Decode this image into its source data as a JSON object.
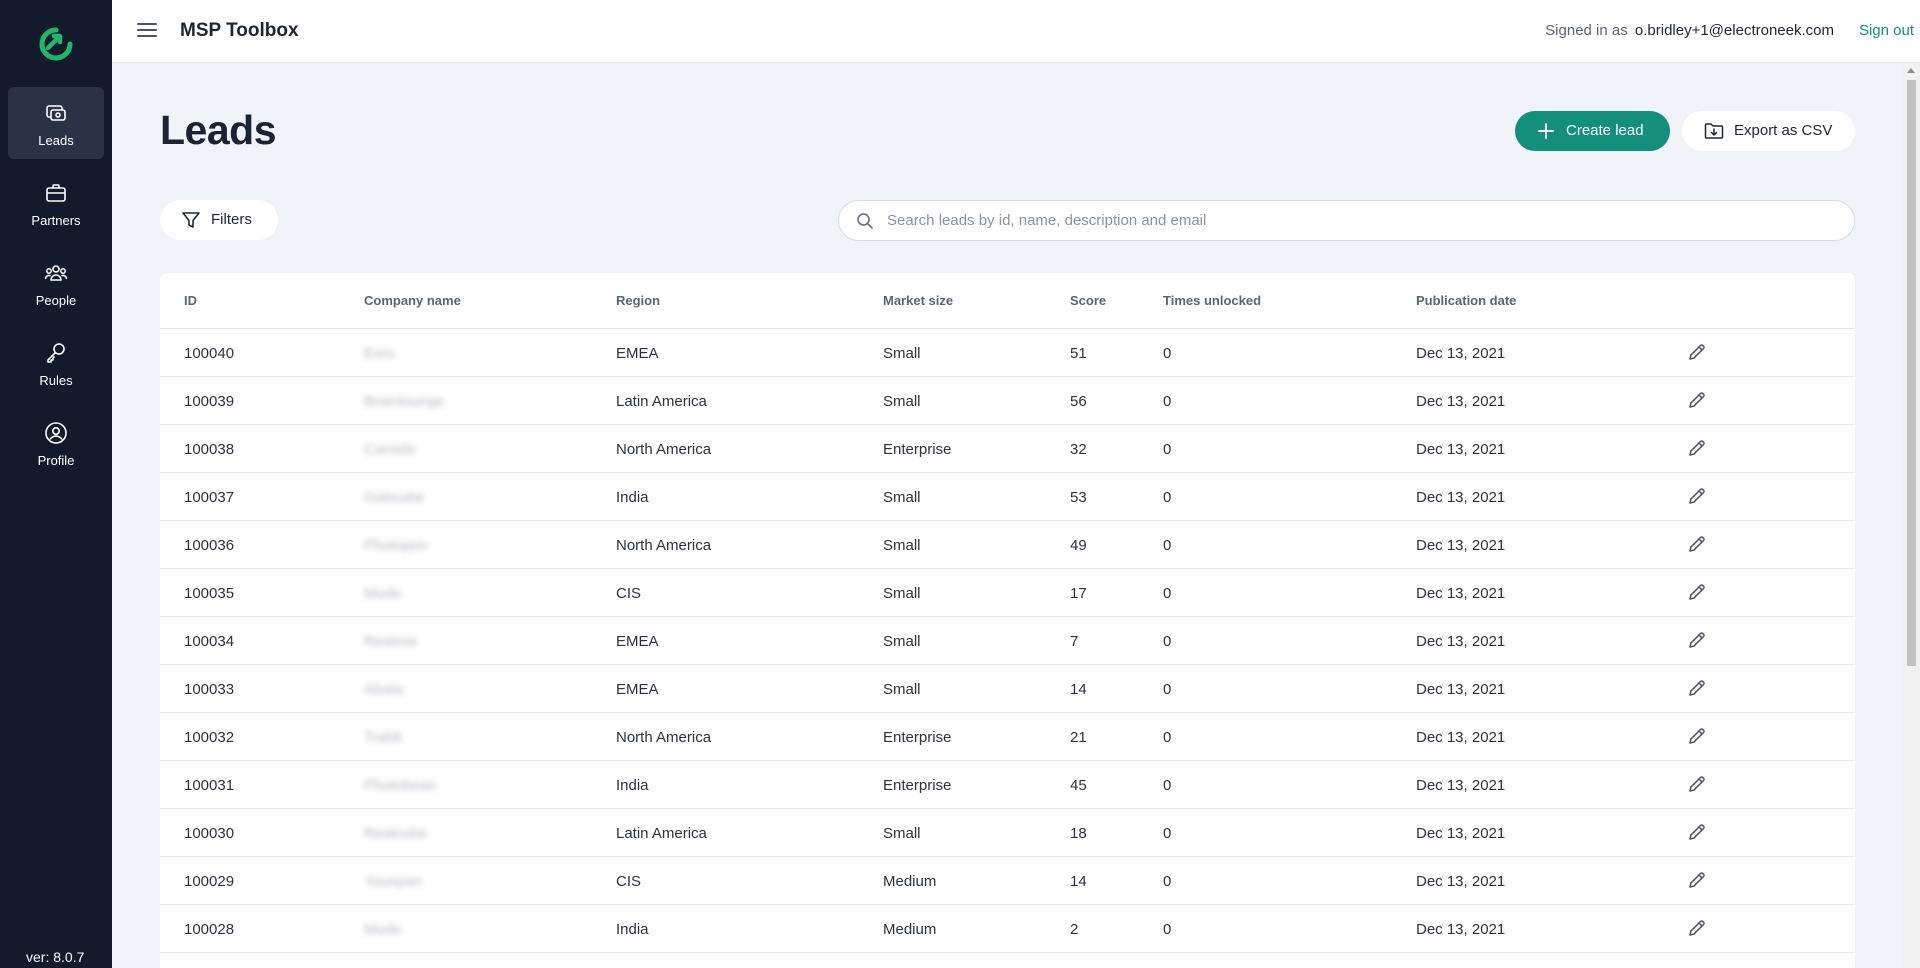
{
  "app": {
    "title": "MSP Toolbox",
    "version": "ver: 8.0.7"
  },
  "sidebar": {
    "items": [
      {
        "label": "Leads",
        "icon": "leads-icon",
        "active": true
      },
      {
        "label": "Partners",
        "icon": "briefcase-icon",
        "active": false
      },
      {
        "label": "People",
        "icon": "people-icon",
        "active": false
      },
      {
        "label": "Rules",
        "icon": "key-icon",
        "active": false
      },
      {
        "label": "Profile",
        "icon": "profile-icon",
        "active": false
      }
    ]
  },
  "header": {
    "signed_in_prefix": "Signed in as",
    "email": "o.bridley+1@electroneek.com",
    "sign_out": "Sign out"
  },
  "page": {
    "title": "Leads",
    "create_label": "Create lead",
    "export_label": "Export as CSV",
    "filters_label": "Filters",
    "search_placeholder": "Search leads by id, name, description and email"
  },
  "table": {
    "columns": [
      "ID",
      "Company name",
      "Region",
      "Market size",
      "Score",
      "Times unlocked",
      "Publication date"
    ],
    "rows": [
      {
        "id": "100040",
        "company": "Exro",
        "region": "EMEA",
        "market_size": "Small",
        "score": "51",
        "times_unlocked": "0",
        "date": "Dec 13, 2021"
      },
      {
        "id": "100039",
        "company": "Brainlounge",
        "region": "Latin America",
        "market_size": "Small",
        "score": "56",
        "times_unlocked": "0",
        "date": "Dec 13, 2021"
      },
      {
        "id": "100038",
        "company": "Camido",
        "region": "North America",
        "market_size": "Enterprise",
        "score": "32",
        "times_unlocked": "0",
        "date": "Dec 13, 2021"
      },
      {
        "id": "100037",
        "company": "Gabcube",
        "region": "India",
        "market_size": "Small",
        "score": "53",
        "times_unlocked": "0",
        "date": "Dec 13, 2021"
      },
      {
        "id": "100036",
        "company": "Photojam",
        "region": "North America",
        "market_size": "Small",
        "score": "49",
        "times_unlocked": "0",
        "date": "Dec 13, 2021"
      },
      {
        "id": "100035",
        "company": "Mudo",
        "region": "CIS",
        "market_size": "Small",
        "score": "17",
        "times_unlocked": "0",
        "date": "Dec 13, 2021"
      },
      {
        "id": "100034",
        "company": "Realmix",
        "region": "EMEA",
        "market_size": "Small",
        "score": "7",
        "times_unlocked": "0",
        "date": "Dec 13, 2021"
      },
      {
        "id": "100033",
        "company": "Abata",
        "region": "EMEA",
        "market_size": "Small",
        "score": "14",
        "times_unlocked": "0",
        "date": "Dec 13, 2021"
      },
      {
        "id": "100032",
        "company": "Trablt",
        "region": "North America",
        "market_size": "Enterprise",
        "score": "21",
        "times_unlocked": "0",
        "date": "Dec 13, 2021"
      },
      {
        "id": "100031",
        "company": "Photobean",
        "region": "India",
        "market_size": "Enterprise",
        "score": "45",
        "times_unlocked": "0",
        "date": "Dec 13, 2021"
      },
      {
        "id": "100030",
        "company": "Realcube",
        "region": "Latin America",
        "market_size": "Small",
        "score": "18",
        "times_unlocked": "0",
        "date": "Dec 13, 2021"
      },
      {
        "id": "100029",
        "company": "Youspan",
        "region": "CIS",
        "market_size": "Medium",
        "score": "14",
        "times_unlocked": "0",
        "date": "Dec 13, 2021"
      },
      {
        "id": "100028",
        "company": "Mudo",
        "region": "India",
        "market_size": "Medium",
        "score": "2",
        "times_unlocked": "0",
        "date": "Dec 13, 2021"
      }
    ]
  },
  "colors": {
    "sidebar_bg": "#131a2c",
    "accent": "#148f7c",
    "page_bg": "#f0f3f7"
  }
}
